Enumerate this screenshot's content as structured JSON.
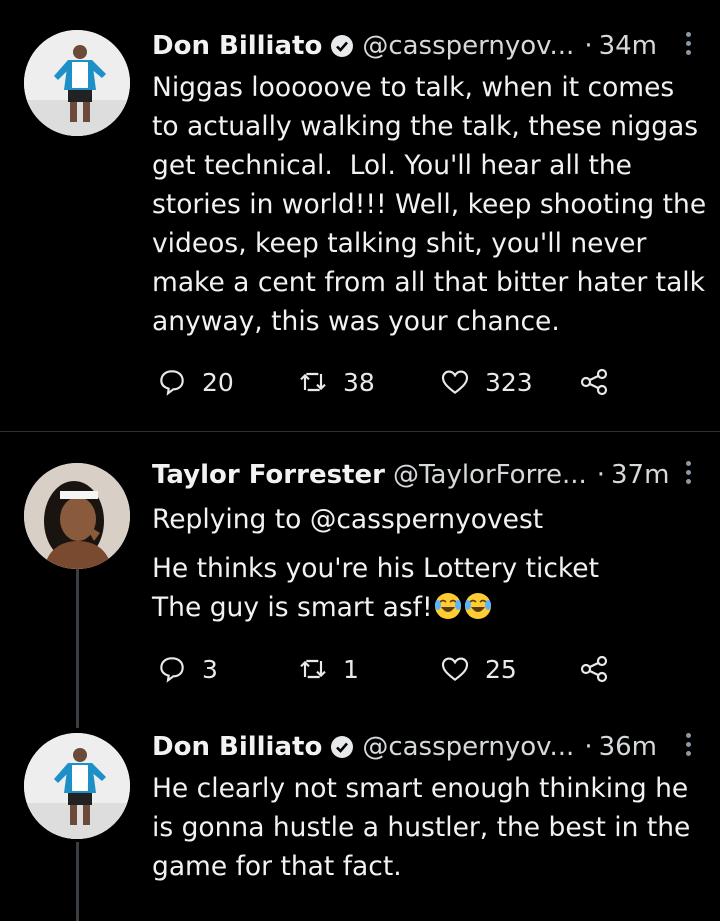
{
  "tweets": [
    {
      "name": "Don Billiato",
      "handle": "@casspernyov...",
      "separator": "·",
      "time": "34m",
      "lines": [
        "Niggas looooove to talk, when it comes",
        "to actually walking the talk, these niggas",
        "get technical.  Lol. You'll hear all the",
        "stories in world!!! Well, keep shooting the",
        "videos, keep talking shit, you'll never",
        "make a cent from all that bitter hater talk",
        "anyway, this was your chance."
      ],
      "replies": "20",
      "retweets": "38",
      "likes": "323"
    },
    {
      "name": "Taylor Forrester",
      "handle": "@TaylorForre...",
      "separator": "·",
      "time": "37m",
      "replying": "Replying to @casspernyovest",
      "lines": [
        "He thinks you're his Lottery ticket",
        "The guy is smart asf!"
      ],
      "emojis": [
        "face-with-tears-of-joy",
        "face-with-tears-of-joy"
      ],
      "replies": "3",
      "retweets": "1",
      "likes": "25"
    },
    {
      "name": "Don Billiato",
      "handle": "@casspernyov...",
      "separator": "·",
      "time": "36m",
      "lines": [
        "He clearly not smart enough thinking he",
        "is gonna hustle a hustler, the best in the",
        "game for that fact."
      ]
    }
  ],
  "icons": {
    "verified": "verified-badge-icon",
    "reply": "reply-icon",
    "retweet": "retweet-icon",
    "like": "heart-icon",
    "share": "share-icon",
    "more": "more-vertical-icon"
  },
  "colors": {
    "background": "#000000",
    "text": "#f2f2f2",
    "muted": "#8b98a5"
  }
}
